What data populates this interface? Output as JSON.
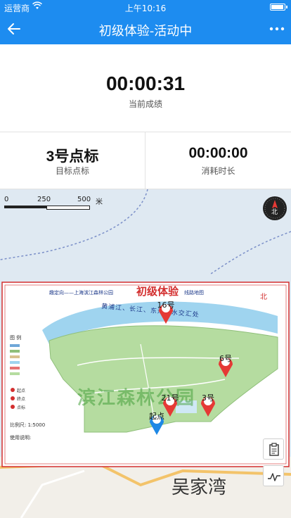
{
  "status_bar": {
    "carrier": "运营商",
    "time": "上午10:16"
  },
  "header": {
    "title": "初级体验-活动中",
    "back_icon": "arrow-left-icon",
    "more_icon": "more-dots-icon"
  },
  "score": {
    "time": "00:00:31",
    "label": "当前成绩"
  },
  "stats": {
    "target": {
      "value": "3号点标",
      "label": "目标点标"
    },
    "elapsed": {
      "value": "00:00:00",
      "label": "消耗时长"
    }
  },
  "map": {
    "scale": {
      "zero": "0",
      "mid": "250",
      "max": "500",
      "unit": "米"
    },
    "compass_label": "北",
    "place_name": "吴家湾",
    "park_title": "初级体验",
    "park_subtitle": "趣定向——上海滨江森林公园",
    "park_subtitle2": "线路地图",
    "river_label": "黄浦江、长江、东海三水交汇处",
    "watermark": "滨江森林公园",
    "legend_heading": "图  例",
    "legend_scale": "比例尺: 1:5000",
    "legend_north": "北",
    "legend_items": [
      "起点",
      "终点",
      "点标"
    ],
    "instructions_heading": "使用说明:",
    "markers": [
      {
        "label": "16号",
        "type": "red"
      },
      {
        "label": "6号",
        "type": "red"
      },
      {
        "label": "21号",
        "type": "red"
      },
      {
        "label": "3号",
        "type": "red"
      },
      {
        "label": "起点",
        "type": "blue"
      }
    ],
    "side_buttons": [
      "clipboard-icon",
      "track-chart-icon"
    ]
  },
  "colors": {
    "accent": "#1d8cf0",
    "marker_red": "#e53935",
    "marker_blue": "#1e88e5"
  }
}
